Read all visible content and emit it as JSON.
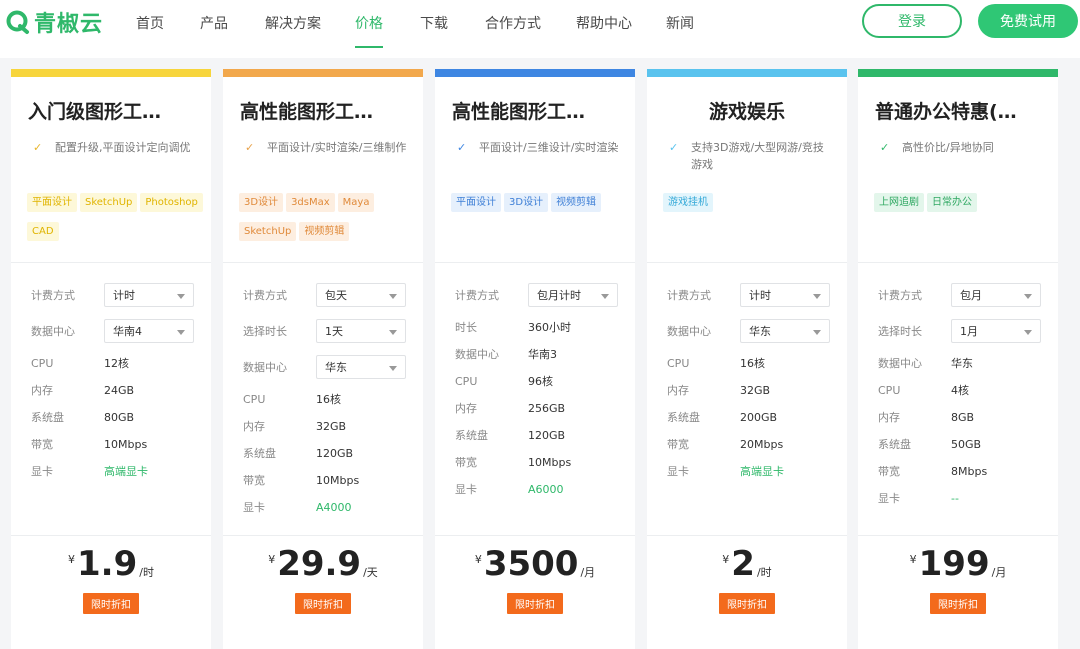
{
  "header": {
    "logo_text": "青椒云",
    "nav": [
      {
        "label": "首页"
      },
      {
        "label": "产品"
      },
      {
        "label": "解决方案"
      },
      {
        "label": "价格"
      },
      {
        "label": "下载"
      },
      {
        "label": "合作方式"
      },
      {
        "label": "帮助中心"
      },
      {
        "label": "新闻"
      }
    ],
    "active_nav": "价格",
    "login_label": "登录",
    "trial_label": "免费试用"
  },
  "colors": {
    "brand": "#2fb86a",
    "promo": "#f36a1c"
  },
  "cards": [
    {
      "title": "入门级图形工…",
      "bar_color": "#f7d53c",
      "check_color": "#e8b52a",
      "feature": "配置升级,平面设计定向调优",
      "tag_style": "yellow",
      "tags": [
        "平面设计",
        "SketchUp",
        "Photoshop",
        "CAD"
      ],
      "selects": [
        {
          "label": "计费方式",
          "value": "计时"
        },
        {
          "label": "数据中心",
          "value": "华南4"
        }
      ],
      "specs": [
        {
          "label": "CPU",
          "value": "12核"
        },
        {
          "label": "内存",
          "value": "24GB"
        },
        {
          "label": "系统盘",
          "value": "80GB"
        },
        {
          "label": "带宽",
          "value": "10Mbps"
        },
        {
          "label": "显卡",
          "value": "高端显卡",
          "green": true
        }
      ],
      "currency": "¥",
      "price": "1.9",
      "unit": "/时",
      "promo": "限时折扣"
    },
    {
      "title": "高性能图形工…",
      "bar_color": "#f2a84c",
      "check_color": "#e8a24a",
      "feature": "平面设计/实时渲染/三维制作",
      "tag_style": "orange",
      "tags": [
        "3D设计",
        "3dsMax",
        "Maya",
        "SketchUp",
        "视频剪辑"
      ],
      "selects": [
        {
          "label": "计费方式",
          "value": "包天"
        },
        {
          "label": "选择时长",
          "value": "1天"
        },
        {
          "label": "数据中心",
          "value": "华东"
        }
      ],
      "specs": [
        {
          "label": "CPU",
          "value": "16核"
        },
        {
          "label": "内存",
          "value": "32GB"
        },
        {
          "label": "系统盘",
          "value": "120GB"
        },
        {
          "label": "带宽",
          "value": "10Mbps"
        },
        {
          "label": "显卡",
          "value": "A4000",
          "green": true
        }
      ],
      "currency": "¥",
      "price": "29.9",
      "unit": "/天",
      "promo": "限时折扣"
    },
    {
      "title": "高性能图形工…",
      "bar_color": "#3e86e2",
      "check_color": "#3e86e2",
      "feature": "平面设计/三维设计/实时渲染",
      "tag_style": "blue",
      "tags": [
        "平面设计",
        "3D设计",
        "视频剪辑"
      ],
      "selects": [
        {
          "label": "计费方式",
          "value": "包月计时"
        }
      ],
      "specs": [
        {
          "label": "时长",
          "value": "360小时"
        },
        {
          "label": "数据中心",
          "value": "华南3"
        },
        {
          "label": "CPU",
          "value": "96核"
        },
        {
          "label": "内存",
          "value": "256GB"
        },
        {
          "label": "系统盘",
          "value": "120GB"
        },
        {
          "label": "带宽",
          "value": "10Mbps"
        },
        {
          "label": "显卡",
          "value": "A6000",
          "green": true
        }
      ],
      "currency": "¥",
      "price": "3500",
      "unit": "/月",
      "promo": "限时折扣"
    },
    {
      "title": "游戏娱乐",
      "title_center": true,
      "bar_color": "#5ac3ee",
      "check_color": "#5ac3ee",
      "feature": "支持3D游戏/大型网游/竞技游戏",
      "tag_style": "cyan",
      "tags": [
        "游戏挂机"
      ],
      "selects": [
        {
          "label": "计费方式",
          "value": "计时"
        },
        {
          "label": "数据中心",
          "value": "华东"
        }
      ],
      "specs": [
        {
          "label": "CPU",
          "value": "16核"
        },
        {
          "label": "内存",
          "value": "32GB"
        },
        {
          "label": "系统盘",
          "value": "200GB"
        },
        {
          "label": "带宽",
          "value": "20Mbps"
        },
        {
          "label": "显卡",
          "value": "高端显卡",
          "green": true
        }
      ],
      "currency": "¥",
      "price": "2",
      "unit": "/时",
      "promo": "限时折扣"
    },
    {
      "title": "普通办公特惠(…",
      "bar_color": "#2fb86a",
      "check_color": "#2fb86a",
      "feature": "高性价比/异地协同",
      "tag_style": "green",
      "tags": [
        "上网追剧",
        "日常办公"
      ],
      "selects": [
        {
          "label": "计费方式",
          "value": "包月"
        },
        {
          "label": "选择时长",
          "value": "1月"
        }
      ],
      "specs": [
        {
          "label": "数据中心",
          "value": "华东"
        },
        {
          "label": "CPU",
          "value": "4核"
        },
        {
          "label": "内存",
          "value": "8GB"
        },
        {
          "label": "系统盘",
          "value": "50GB"
        },
        {
          "label": "带宽",
          "value": "8Mbps"
        },
        {
          "label": "显卡",
          "value": "--",
          "green": true
        }
      ],
      "currency": "¥",
      "price": "199",
      "unit": "/月",
      "promo": "限时折扣"
    }
  ]
}
